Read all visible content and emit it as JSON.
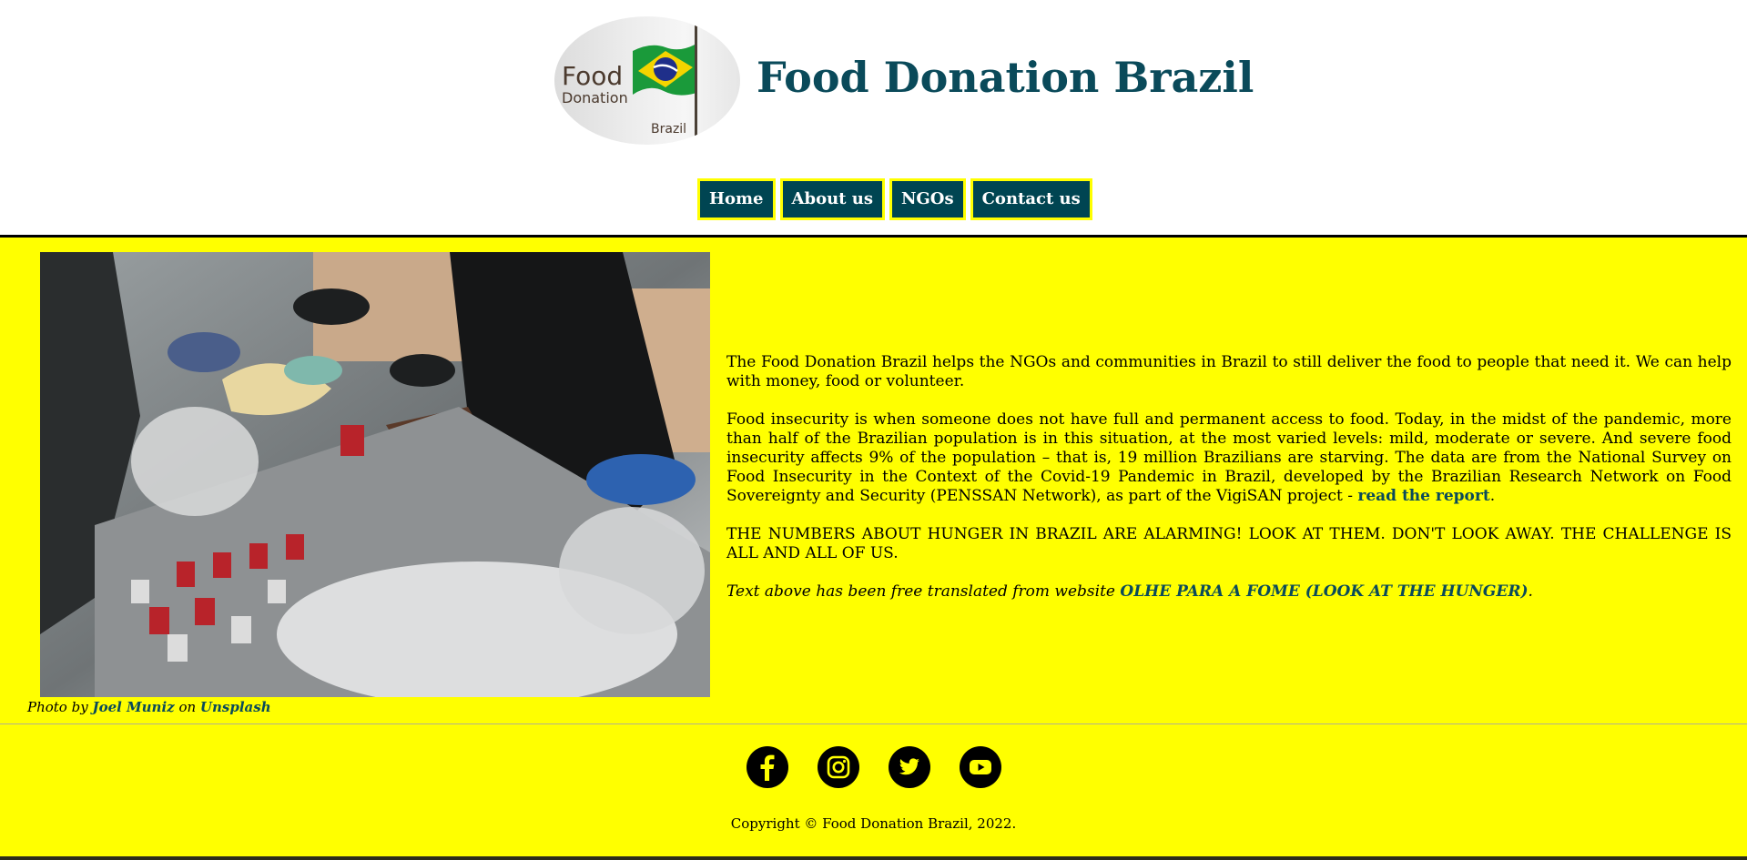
{
  "header": {
    "logo": {
      "word_1": "Food",
      "word_2": "Donation",
      "word_3": "Brazil"
    },
    "title": "Food Donation Brazil"
  },
  "nav": {
    "items": [
      {
        "label": "Home"
      },
      {
        "label": "About us"
      },
      {
        "label": "NGOs"
      },
      {
        "label": "Contact us"
      }
    ]
  },
  "photo": {
    "caption_prefix": "Photo by ",
    "author": "Joel Muniz",
    "caption_mid": " on ",
    "source": "Unsplash"
  },
  "content": {
    "p1": "The Food Donation Brazil helps the NGOs and communities in Brazil to still deliver the food to people that need it. We can help with money, food or volunteer.",
    "p2": "Food insecurity is when someone does not have full and permanent access to food. Today, in the midst of the pandemic, more than half of the Brazilian population is in this situation, at the most varied levels: mild, moderate or severe. And severe food insecurity affects 9% of the population – that is, 19 million Brazilians are starving. The data are from the National Survey on Food Insecurity in the Context of the Covid-19 Pandemic in Brazil, developed by the Brazilian Research Network on Food Sovereignty and Security (PENSSAN Network), as part of the VigiSAN project - ",
    "p2_link": "read the report",
    "p2_end": ".",
    "p3": "THE NUMBERS ABOUT HUNGER IN BRAZIL ARE ALARMING! LOOK AT THEM. DON'T LOOK AWAY. THE CHALLENGE IS ALL AND ALL OF US.",
    "p4": "Text above has been free translated from website ",
    "p4_link": "OLHE PARA A FOME (LOOK AT THE HUNGER)",
    "p4_end": "."
  },
  "footer": {
    "social": [
      "facebook-icon",
      "instagram-icon",
      "twitter-icon",
      "youtube-icon"
    ],
    "copyright": "Copyright © Food Donation Brazil, 2022."
  },
  "colors": {
    "page_background": "#ffff00",
    "header_background": "#ffffff",
    "title": "#0a4a5a",
    "nav_button": "#004552",
    "link": "#0a4a5a"
  }
}
